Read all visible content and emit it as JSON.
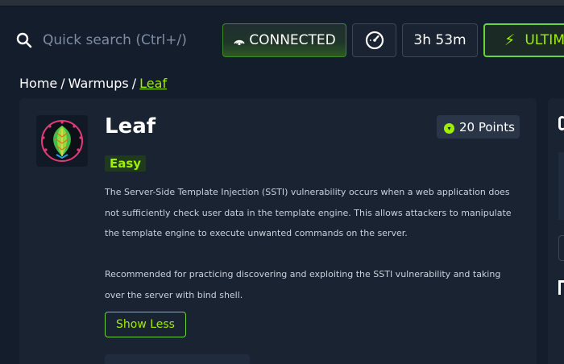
{
  "search": {
    "placeholder": "Quick search (Ctrl+/)"
  },
  "header": {
    "status_label": "CONNECTED",
    "timer": "3h 53m",
    "upgrade_label": "ULTIMA"
  },
  "breadcrumb": {
    "items": [
      "Home",
      "Warmups",
      "Leaf"
    ],
    "separator": "/"
  },
  "challenge": {
    "title": "Leaf",
    "points": "20 Points",
    "difficulty": "Easy",
    "description": [
      "The Server-Side Template Injection (SSTI) vulnerability occurs when a web application does not sufficiently check user data in the template engine. This allows attackers to manipulate the template engine to execute unwanted commands on the server.",
      "Recommended for practicing discovering and exploiting the SSTI vulnerability and taking over the server with bind shell."
    ],
    "toggle_label": "Show Less"
  },
  "colors": {
    "background": "#141d2b",
    "card": "#1a2332",
    "accent": "#9fef00",
    "text_muted": "#a4b1cd"
  },
  "icons": {
    "search": "search-icon",
    "connection": "wifi-signal-icon",
    "speed": "speedometer-icon",
    "upgrade": "lightning-bolt-icon",
    "coin": "coin-icon",
    "logo": "leaf-logo-icon"
  }
}
